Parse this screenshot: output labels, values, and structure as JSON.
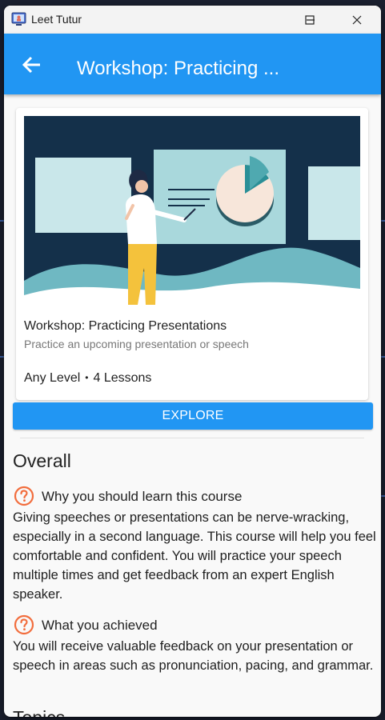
{
  "window": {
    "title": "Leet Tutur",
    "minimize_label": "—",
    "maximize_label": "□",
    "close_label": "✕"
  },
  "appbar": {
    "title": "Workshop: Practicing ...",
    "back_icon": "arrow-left-icon"
  },
  "course": {
    "title": "Workshop: Practicing Presentations",
    "subtitle": "Practice an upcoming presentation or speech",
    "level": "Any Level",
    "separator": "•",
    "lessons": "4 Lessons"
  },
  "explore_label": "EXPLORE",
  "overall": {
    "heading": "Overall",
    "sections": [
      {
        "icon": "question-circle-icon",
        "title": "Why you should learn this course",
        "body": "Giving speeches or presentations can be nerve-wracking, especially in a second language. This course will help you feel comfortable and confident. You will practice your speech multiple times and get feedback from an expert English speaker."
      },
      {
        "icon": "question-circle-icon",
        "title": "What you achieved",
        "body": "You will receive valuable feedback on your presentation or speech in areas such as pronunciation, pacing, and grammar."
      }
    ]
  },
  "topics_heading": "Topics",
  "colors": {
    "primary": "#2196f3",
    "accent_icon": "#f26d3d",
    "illustration_dark": "#14304a",
    "illustration_teal": "#6fb8c2"
  }
}
